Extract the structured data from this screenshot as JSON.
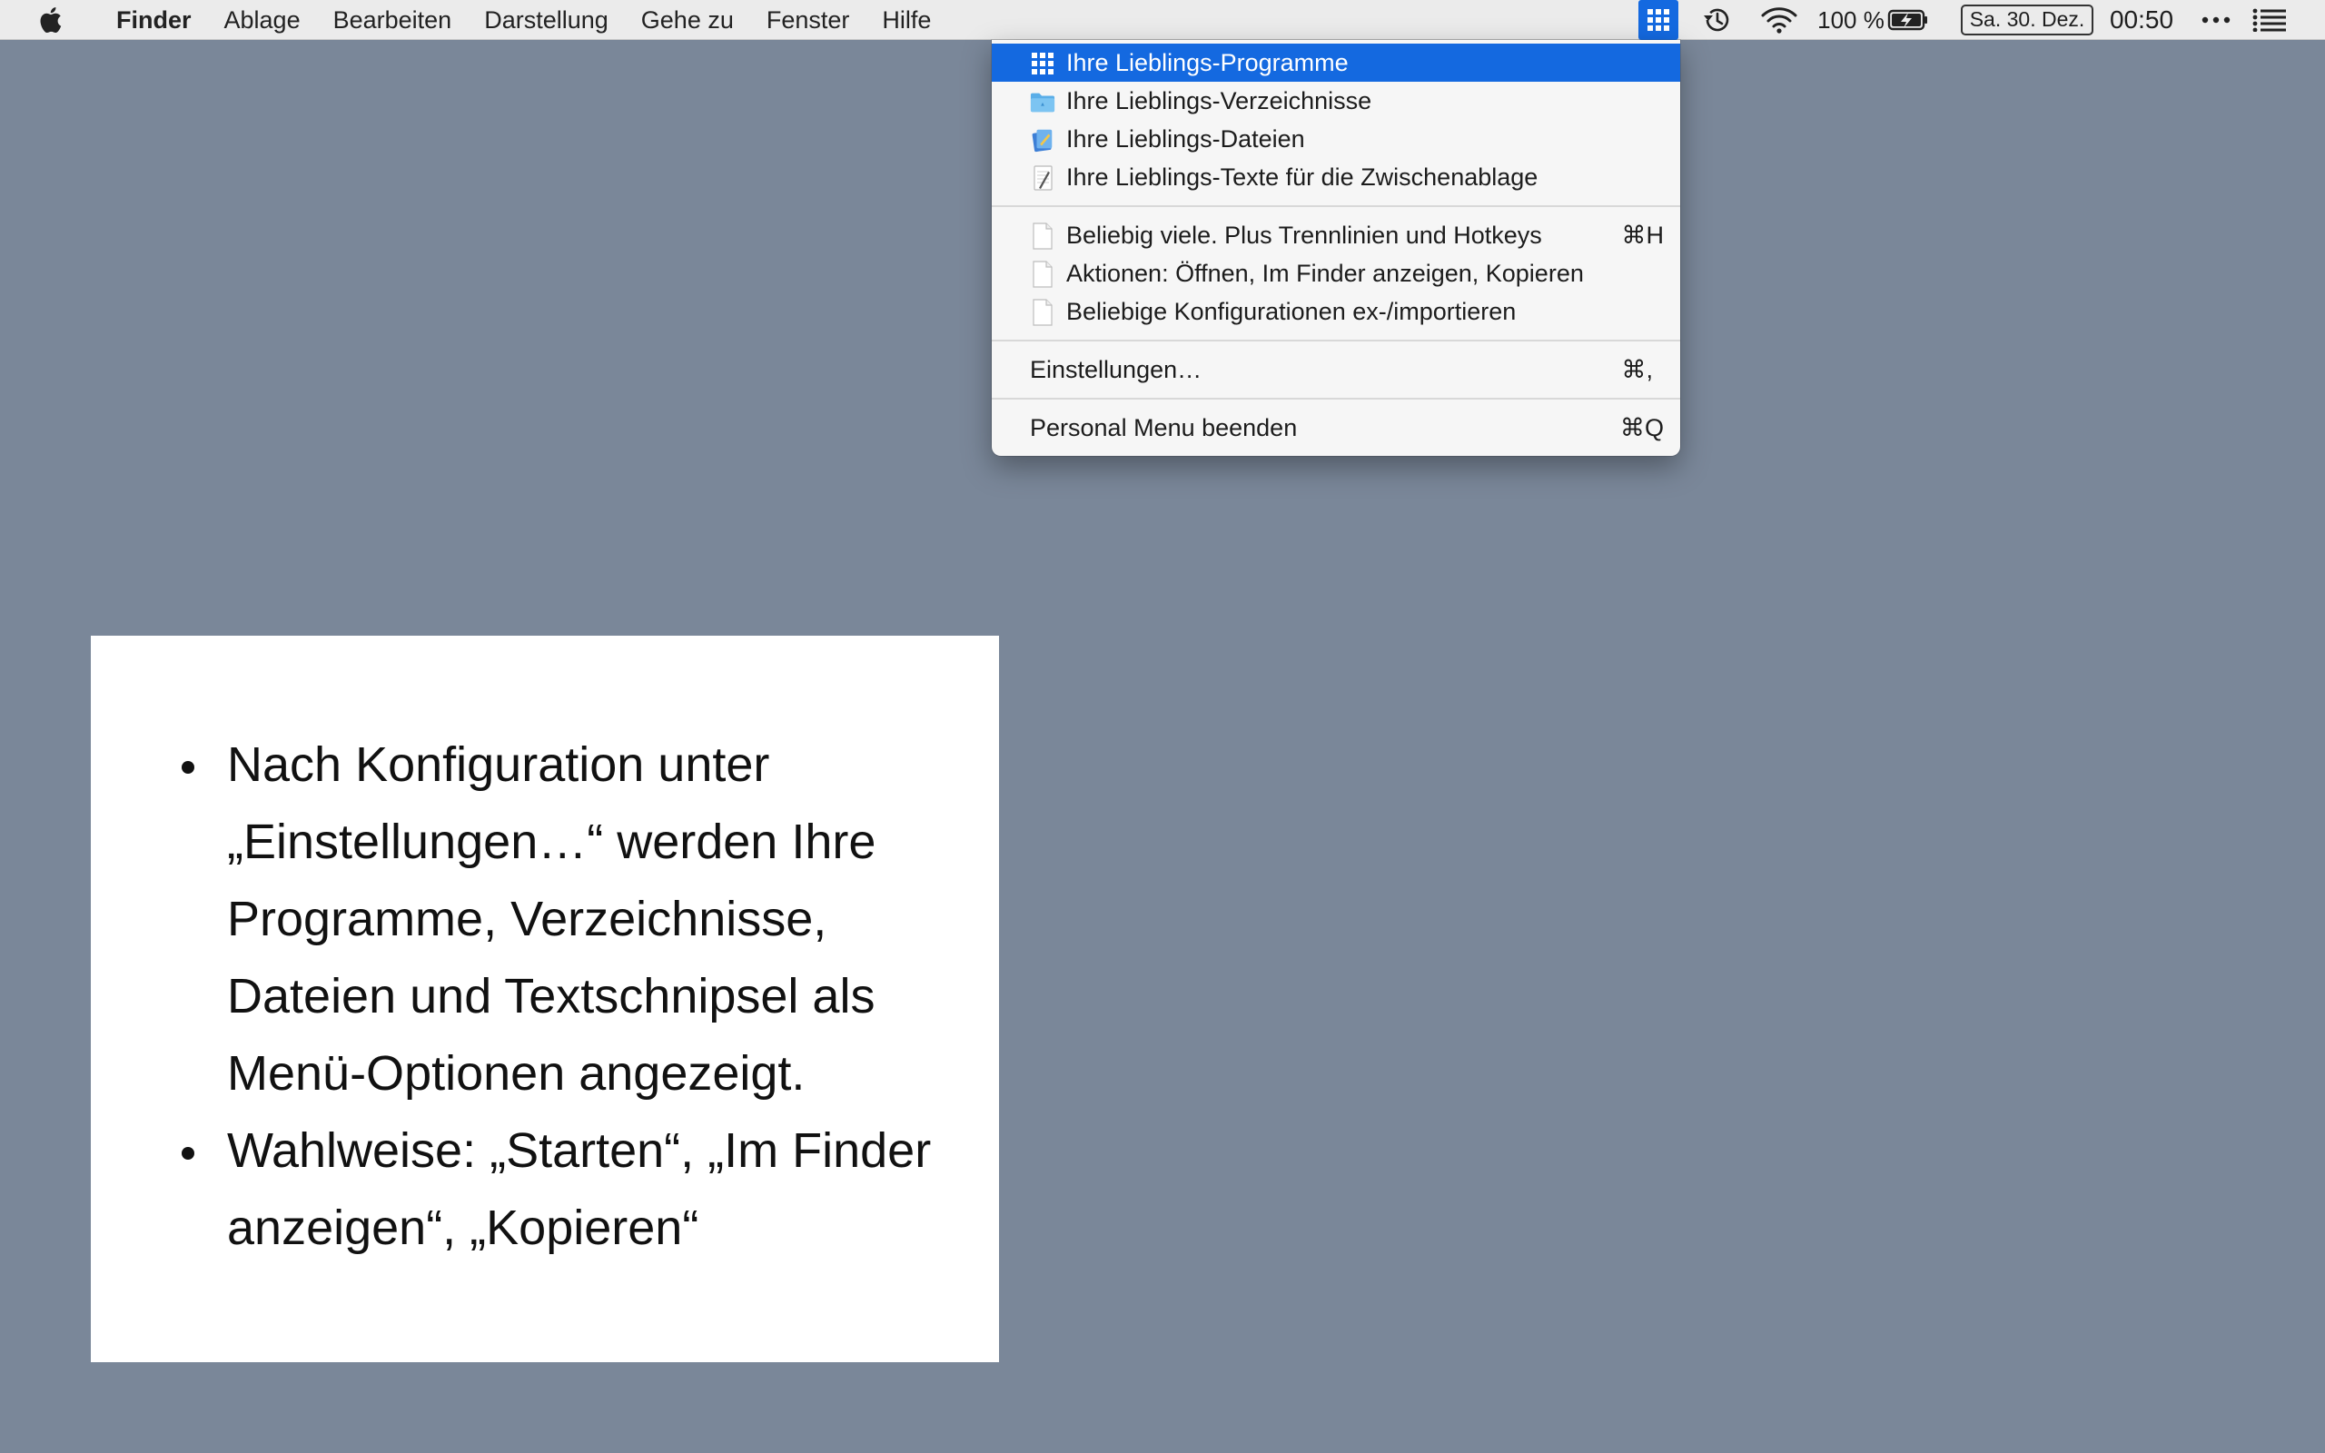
{
  "menubar": {
    "apple_icon": "apple-logo-icon",
    "app_name": "Finder",
    "menus": [
      "Ablage",
      "Bearbeiten",
      "Darstellung",
      "Gehe zu",
      "Fenster",
      "Hilfe"
    ],
    "status": {
      "personal_menu_icon": "grid-icon",
      "time_machine_icon": "time-machine-icon",
      "wifi_icon": "wifi-icon",
      "battery_percent": "100 %",
      "battery_icon": "battery-charging-icon",
      "date": "Sa. 30. Dez.",
      "time": "00:50",
      "more_icon": "ellipsis-icon",
      "notification_icon": "list-icon"
    }
  },
  "dropdown": {
    "selected_color": "#1469e0",
    "group1": [
      {
        "icon": "grid-icon",
        "label": "Ihre Lieblings-Programme"
      },
      {
        "icon": "folder-icon",
        "label": "Ihre Lieblings-Verzeichnisse"
      },
      {
        "icon": "document-app-icon",
        "label": "Ihre Lieblings-Dateien"
      },
      {
        "icon": "textedit-icon",
        "label": "Ihre Lieblings-Texte für die Zwischenablage"
      }
    ],
    "group2": [
      {
        "icon": "file-icon",
        "label": "Beliebig viele. Plus Trennlinien und Hotkeys",
        "shortcut": "⌘H"
      },
      {
        "icon": "file-icon",
        "label": "Aktionen: Öffnen, Im Finder anzeigen, Kopieren"
      },
      {
        "icon": "file-icon",
        "label": "Beliebige Konfigurationen ex-/importieren"
      }
    ],
    "settings": {
      "label": "Einstellungen…",
      "shortcut": "⌘,"
    },
    "quit": {
      "label": "Personal Menu beenden",
      "shortcut": "⌘Q"
    }
  },
  "panel": {
    "bullets": [
      "Nach Konfiguration unter „Einstellungen…“ werden Ihre Programme, Verzeichnisse, Dateien und Textschnipsel als Menü-Optionen angezeigt.",
      "Wahlweise: „Starten“, „Im Finder anzeigen“, „Kopieren“"
    ]
  }
}
